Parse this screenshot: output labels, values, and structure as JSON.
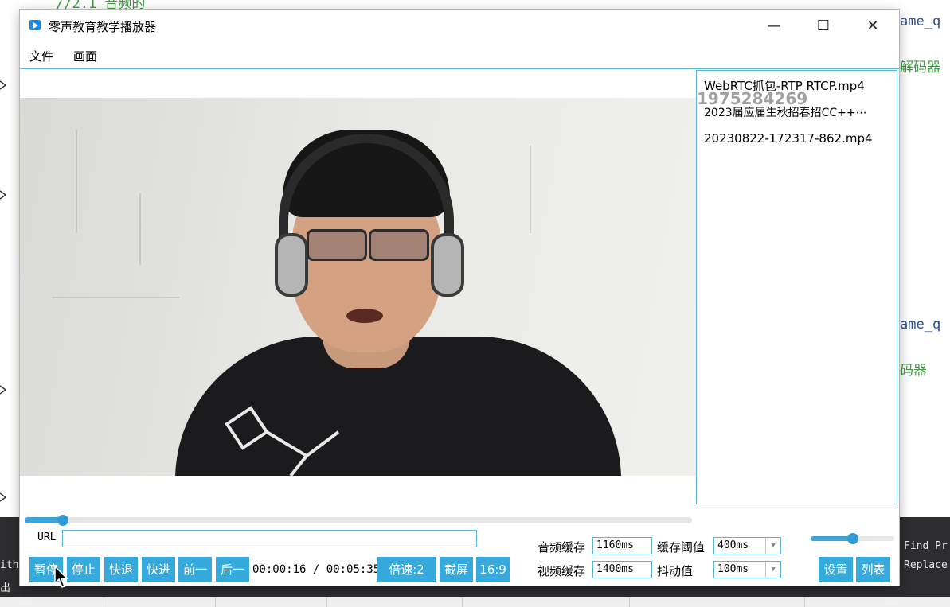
{
  "background": {
    "code_top": "//2.1 音频的",
    "right_lines": [
      "ame_q",
      "解码器",
      "ame_q",
      "码器"
    ],
    "side_labels": [
      "Find Pr",
      "Replace"
    ],
    "left_labels": [
      "ith",
      "出"
    ]
  },
  "window": {
    "title": "零声教育教学播放器",
    "controls": {
      "minimize": "—",
      "maximize": "☐",
      "close": "✕"
    }
  },
  "menu": {
    "items": [
      "文件",
      "画面"
    ]
  },
  "playlist": {
    "items": [
      "WebRTC抓包-RTP RTCP.mp4",
      "2023届应届生秋招春招CC++⋯",
      "20230822-172317-862.mp4"
    ],
    "watermark": "1975284269"
  },
  "progress": {
    "fraction": 0.057
  },
  "url": {
    "label": "URL",
    "value": ""
  },
  "buttons": {
    "pause": "暂停",
    "stop": "停止",
    "rewind": "快退",
    "forward": "快进",
    "prev": "前一",
    "next": "后一",
    "speed": "倍速:2",
    "screenshot": "截屏",
    "ratio": "16:9",
    "settings": "设置",
    "list": "列表"
  },
  "time": {
    "current": "00:00:16",
    "separator": "/",
    "total": "00:05:35"
  },
  "buffer": {
    "audio_label": "音频缓存",
    "audio_value": "1160ms",
    "video_label": "视频缓存",
    "video_value": "1400ms",
    "threshold_label": "缓存阈值",
    "threshold_value": "400ms",
    "jitter_label": "抖动值",
    "jitter_value": "100ms"
  },
  "volume": {
    "fraction": 0.5
  },
  "colors": {
    "accent": "#36a9dd",
    "border": "#5fb3d4"
  }
}
